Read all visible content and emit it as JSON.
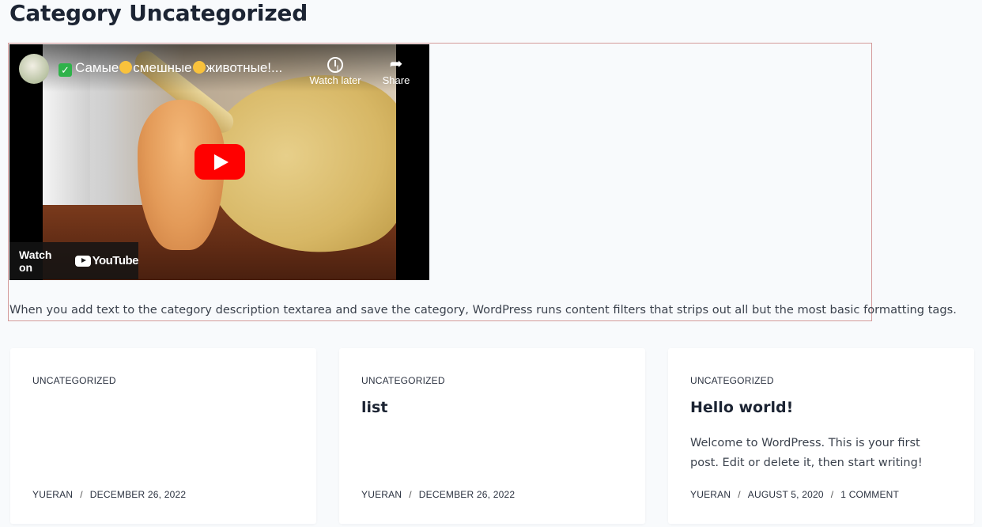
{
  "page": {
    "title": "Category Uncategorized"
  },
  "video": {
    "title": "Самые смешные животные!...",
    "title_parts": [
      "Самые",
      "смешные",
      "животные!..."
    ],
    "watch_later_label": "Watch later",
    "share_label": "Share",
    "watch_on_label": "Watch on",
    "youtube_label": "YouTube"
  },
  "description": {
    "text": "When you add text to the category description textarea and save the category, WordPress runs content filters that strips out all but the most basic formatting tags."
  },
  "posts": [
    {
      "category": "UNCATEGORIZED",
      "title": "",
      "excerpt": "",
      "author": "YUERAN",
      "date": "DECEMBER 26, 2022",
      "comments": ""
    },
    {
      "category": "UNCATEGORIZED",
      "title": "list",
      "excerpt": "",
      "author": "YUERAN",
      "date": "DECEMBER 26, 2022",
      "comments": ""
    },
    {
      "category": "UNCATEGORIZED",
      "title": "Hello world!",
      "excerpt": "Welcome to WordPress. This is your first post. Edit or delete it, then start writing!",
      "author": "YUERAN",
      "date": "AUGUST 5, 2020",
      "comments": "1 COMMENT"
    }
  ],
  "meta_separator": "/",
  "colors": {
    "background": "#f8fafc",
    "card": "#ffffff",
    "heading": "#1c2433",
    "box_border": "#d49a9a",
    "youtube_red": "#ff0000"
  }
}
